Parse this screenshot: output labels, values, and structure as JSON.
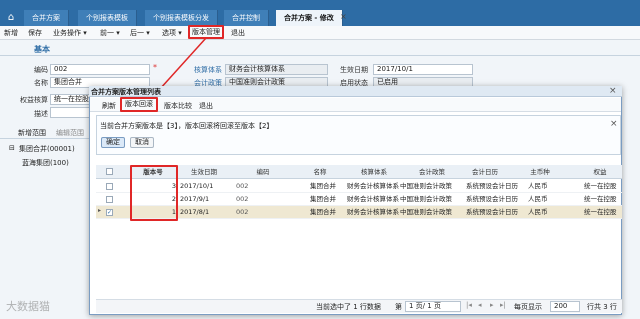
{
  "tabs": [
    "合并方案",
    "个别报表模板",
    "个别报表模板分发",
    "合并控制",
    "合并方案 - 修改"
  ],
  "toolbar": {
    "new": "新增",
    "save": "保存",
    "biz": "业务操作 ▾",
    "prev": "前一 ▾",
    "next": "后一 ▾",
    "options": "选项 ▾",
    "version_mgmt": "版本管理",
    "exit": "退出"
  },
  "section": "基本",
  "form": {
    "code_label": "编码",
    "code": "002",
    "name_label": "名称",
    "name": "集团合并",
    "equity_label": "权益核算",
    "equity": "统一在控股",
    "desc_label": "描述",
    "acct_label": "核算体系",
    "acct": "财务会计核算体系",
    "policy_label": "会计政策",
    "policy": "中国准则会计政策",
    "eff_label": "生效日期",
    "eff": "2017/10/1",
    "use_label": "启用状态",
    "use": "已启用"
  },
  "left": {
    "tab1": "新增范围",
    "tab2": "编辑范围",
    "tree1": "集团合并(00001)",
    "tree2": "蓝海集团(100)"
  },
  "dialog": {
    "title": "合并方案版本管理列表",
    "refresh": "刷新",
    "rollback": "版本回滚",
    "compare": "版本比较",
    "exit": "退出",
    "message": "当前合并方案版本是【3】，版本回滚将回滚至版本【2】",
    "ok": "确定",
    "cancel": "取消",
    "headers": [
      "版本号",
      "生效日期",
      "编码",
      "名称",
      "核算体系",
      "会计政策",
      "会计日历",
      "主币种",
      "权益"
    ],
    "rows": [
      {
        "ver": "3",
        "date": "2017/10/1",
        "code": "002",
        "name": "集团合并",
        "acct": "财务会计核算体系",
        "policy": "中国准则会计政策",
        "cal": "系统预设会计日历",
        "cur": "人民币",
        "eq": "统一在控股"
      },
      {
        "ver": "2",
        "date": "2017/9/1",
        "code": "002",
        "name": "集团合并",
        "acct": "财务会计核算体系",
        "policy": "中国准则会计政策",
        "cal": "系统预设会计日历",
        "cur": "人民币",
        "eq": "统一在控股"
      },
      {
        "ver": "1",
        "date": "2017/8/1",
        "code": "002",
        "name": "集团合并",
        "acct": "财务会计核算体系",
        "policy": "中国准则会计政策",
        "cal": "系统预设会计日历",
        "cur": "人民币",
        "eq": "统一在控股"
      }
    ],
    "pager": {
      "selected": "当前选中了 1 行数据",
      "page_pre": "第",
      "page": "1 页/ 1 页",
      "per_page_label": "每页显示",
      "per_page": "200",
      "total": "行共 3 行"
    }
  },
  "watermark": "大数据猫"
}
